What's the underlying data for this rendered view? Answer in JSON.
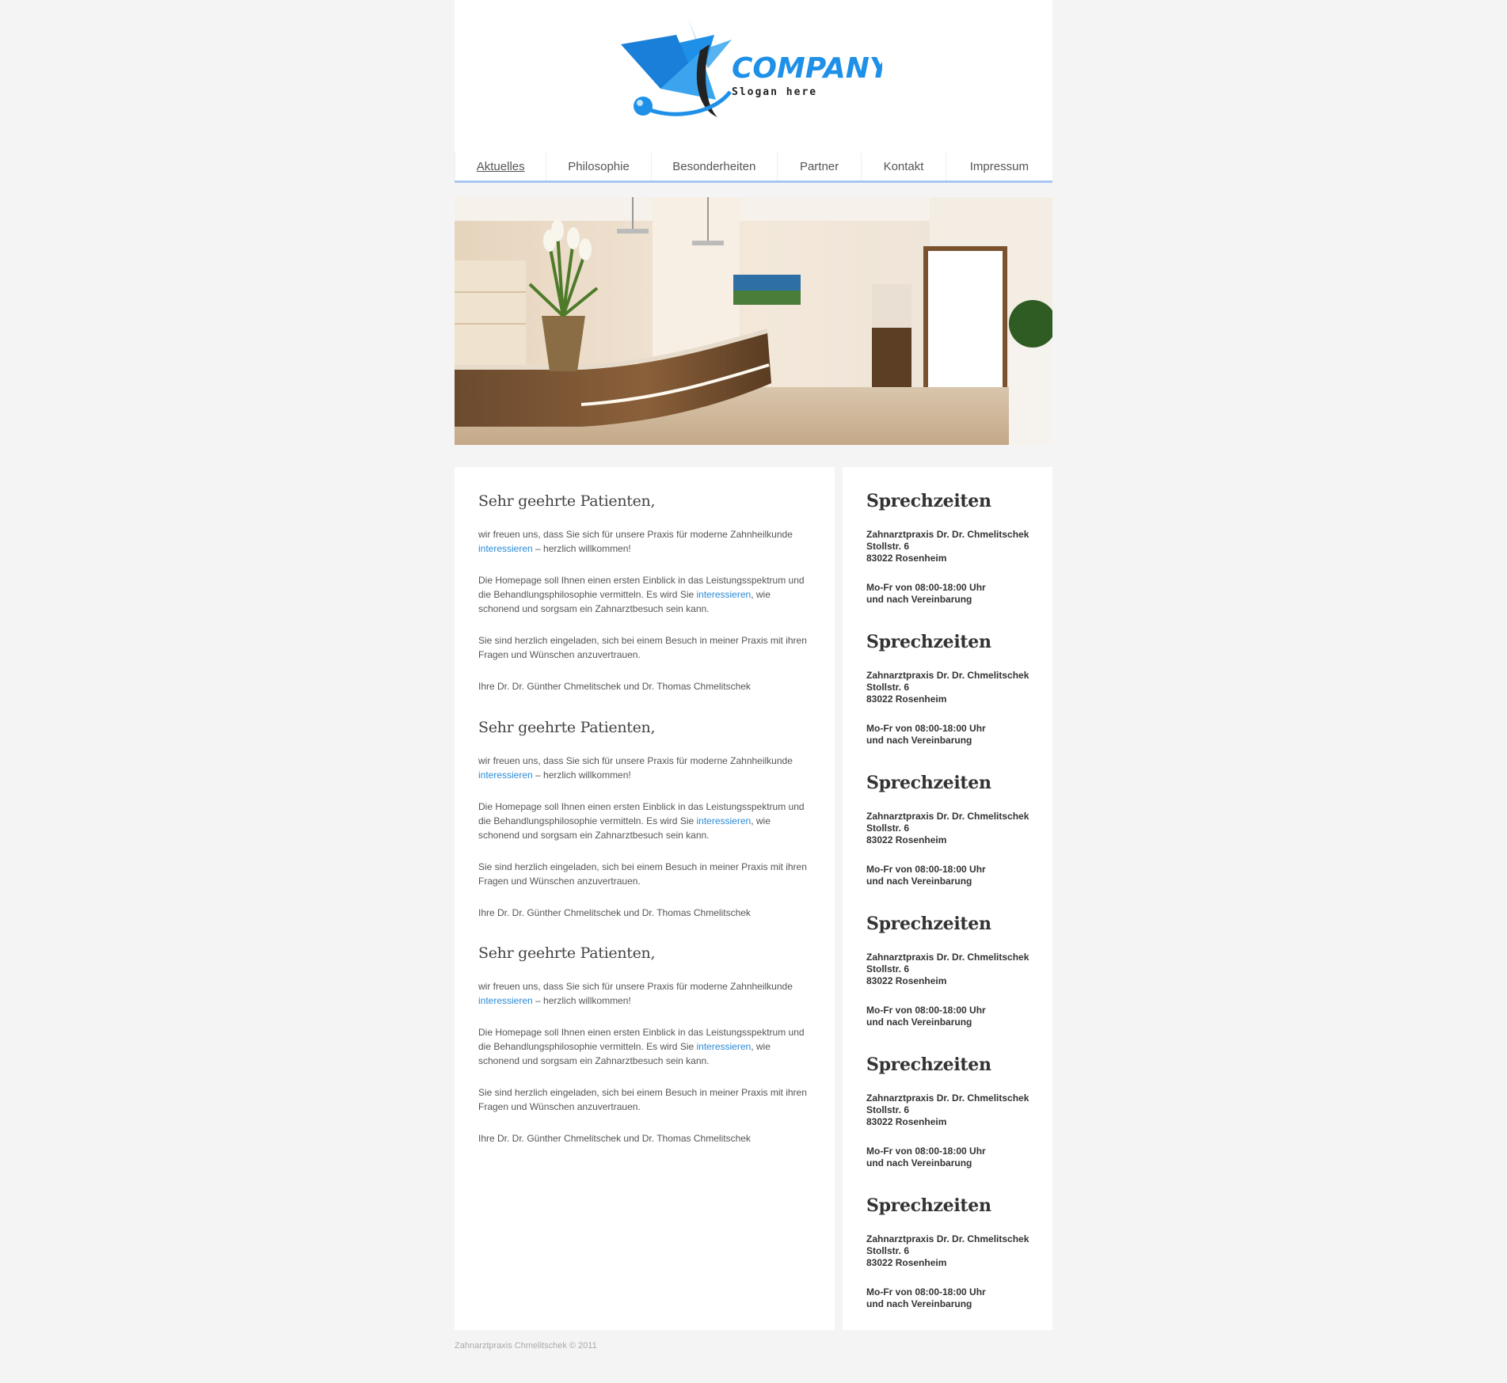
{
  "logo": {
    "wordmark": "COMPANY",
    "slogan": "Slogan here"
  },
  "nav": {
    "items": [
      {
        "label": "Aktuelles",
        "active": true
      },
      {
        "label": "Philosophie",
        "active": false
      },
      {
        "label": "Besonderheiten",
        "active": false
      },
      {
        "label": "Partner",
        "active": false
      },
      {
        "label": "Kontakt",
        "active": false
      },
      {
        "label": "Impressum",
        "active": false
      }
    ]
  },
  "articles": [
    {
      "heading": "Sehr geehrte Patienten,",
      "p1_pre": "wir freuen uns, dass Sie sich für unsere Praxis für moderne Zahnheilkunde",
      "p1_link": "interessieren",
      "p1_post": " – herzlich willkommen!",
      "p2_pre": "Die Homepage soll Ihnen einen ersten Einblick in das Leistungsspektrum und die Behandlungsphilosophie vermitteln. Es wird Sie ",
      "p2_link": "interessieren",
      "p2_post": ", wie schonend und sorgsam ein Zahnarztbesuch sein kann.",
      "p3": "Sie sind herzlich eingeladen, sich bei einem Besuch in meiner Praxis mit ihren Fragen und Wünschen anzuvertrauen.",
      "p4": "Ihre Dr. Dr. Günther Chmelitschek und Dr. Thomas Chmelitschek"
    },
    {
      "heading": "Sehr geehrte Patienten,",
      "p1_pre": "wir freuen uns, dass Sie sich für unsere Praxis für moderne Zahnheilkunde",
      "p1_link": "interessieren",
      "p1_post": " – herzlich willkommen!",
      "p2_pre": "Die Homepage soll Ihnen einen ersten Einblick in das Leistungsspektrum und die Behandlungsphilosophie vermitteln. Es wird Sie ",
      "p2_link": "interessieren",
      "p2_post": ", wie schonend und sorgsam ein Zahnarztbesuch sein kann.",
      "p3": "Sie sind herzlich eingeladen, sich bei einem Besuch in meiner Praxis mit ihren Fragen und Wünschen anzuvertrauen.",
      "p4": "Ihre Dr. Dr. Günther Chmelitschek und Dr. Thomas Chmelitschek"
    },
    {
      "heading": "Sehr geehrte Patienten,",
      "p1_pre": "wir freuen uns, dass Sie sich für unsere Praxis für moderne Zahnheilkunde",
      "p1_link": "interessieren",
      "p1_post": " – herzlich willkommen!",
      "p2_pre": "Die Homepage soll Ihnen einen ersten Einblick in das Leistungsspektrum und die Behandlungsphilosophie vermitteln. Es wird Sie ",
      "p2_link": "interessieren",
      "p2_post": ", wie schonend und sorgsam ein Zahnarztbesuch sein kann.",
      "p3": "Sie sind herzlich eingeladen, sich bei einem Besuch in meiner Praxis mit ihren Fragen und Wünschen anzuvertrauen.",
      "p4": "Ihre Dr. Dr. Günther Chmelitschek und Dr. Thomas Chmelitschek"
    }
  ],
  "sidebar": {
    "blocks": [
      {
        "heading": "Sprechzeiten",
        "name": "Zahnarztpraxis Dr. Dr. Chmelitschek",
        "street": "Stollstr. 6",
        "city": "83022 Rosenheim",
        "hours": "Mo-Fr von 08:00-18:00 Uhr",
        "hours2": "und nach Vereinbarung"
      },
      {
        "heading": "Sprechzeiten",
        "name": "Zahnarztpraxis Dr. Dr. Chmelitschek",
        "street": "Stollstr. 6",
        "city": "83022 Rosenheim",
        "hours": "Mo-Fr von 08:00-18:00 Uhr",
        "hours2": "und nach Vereinbarung"
      },
      {
        "heading": "Sprechzeiten",
        "name": "Zahnarztpraxis Dr. Dr. Chmelitschek",
        "street": "Stollstr. 6",
        "city": "83022 Rosenheim",
        "hours": "Mo-Fr von 08:00-18:00 Uhr",
        "hours2": "und nach Vereinbarung"
      },
      {
        "heading": "Sprechzeiten",
        "name": "Zahnarztpraxis Dr. Dr. Chmelitschek",
        "street": "Stollstr. 6",
        "city": "83022 Rosenheim",
        "hours": "Mo-Fr von 08:00-18:00 Uhr",
        "hours2": "und nach Vereinbarung"
      },
      {
        "heading": "Sprechzeiten",
        "name": "Zahnarztpraxis Dr. Dr. Chmelitschek",
        "street": "Stollstr. 6",
        "city": "83022 Rosenheim",
        "hours": "Mo-Fr von 08:00-18:00 Uhr",
        "hours2": "und nach Vereinbarung"
      },
      {
        "heading": "Sprechzeiten",
        "name": "Zahnarztpraxis Dr. Dr. Chmelitschek",
        "street": "Stollstr. 6",
        "city": "83022 Rosenheim",
        "hours": "Mo-Fr von 08:00-18:00 Uhr",
        "hours2": "und nach Vereinbarung"
      }
    ]
  },
  "footer": {
    "text": "Zahnarztpraxis Chmelitschek © 2011"
  },
  "colors": {
    "link": "#2a8ad6",
    "nav_underline": "#a9c6f3",
    "logo_blue": "#1e90e8"
  }
}
